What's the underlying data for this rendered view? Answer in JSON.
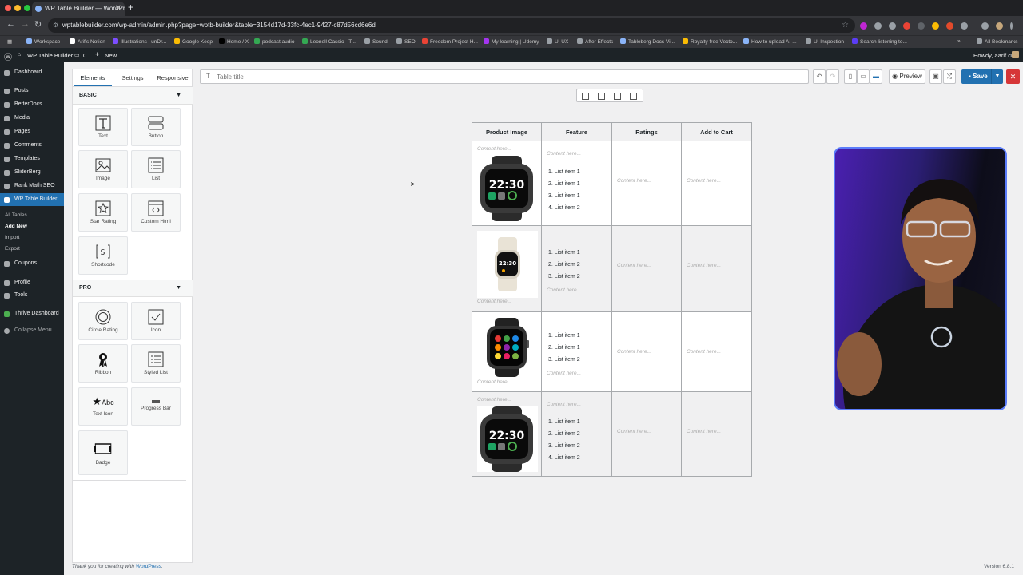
{
  "browser": {
    "tab_title": "WP Table Builder — WordPre",
    "url": "wptablebuilder.com/wp-admin/admin.php?page=wptb-builder&table=3154d17d-33fc-4ec1-9427-c87d56cd6e6d",
    "bookmarks": [
      "Workspace",
      "Arif's Notion",
      "Illustrations | unDr...",
      "Google Keep",
      "Home / X",
      "podcast audio",
      "Leonell Cassio - T...",
      "Sound",
      "SEO",
      "Freedom Project H...",
      "My learning | Udemy",
      "UI UX",
      "After Effects",
      "Tableberg Docs Vi...",
      "Royalty free Vecto...",
      "How to upload AI-...",
      "UI Inspection",
      "Search listening to..."
    ],
    "all_bookmarks": "All Bookmarks"
  },
  "admin_bar": {
    "site": "WP Table Builder",
    "comments": "0",
    "new": "New",
    "howdy": "Howdy, aarif.cu"
  },
  "sidebar": {
    "items": [
      "Dashboard",
      "Posts",
      "BetterDocs",
      "Media",
      "Pages",
      "Comments",
      "Templates",
      "SliderBerg",
      "Rank Math SEO",
      "WP Table Builder"
    ],
    "sub": [
      "All Tables",
      "Add New",
      "Import",
      "Export"
    ],
    "lower": [
      "Coupons",
      "Profile",
      "Tools",
      "Thrive Dashboard",
      "Collapse Menu"
    ]
  },
  "panel": {
    "tabs": [
      "Elements",
      "Settings",
      "Responsive"
    ],
    "basic_label": "BASIC",
    "pro_label": "PRO",
    "basic": [
      "Text",
      "Button",
      "Image",
      "List",
      "Star Rating",
      "Custom Html",
      "Shortcode"
    ],
    "pro": [
      "Circle Rating",
      "Icon",
      "Ribbon",
      "Styled List",
      "Text Icon",
      "Progress Bar",
      "Badge"
    ],
    "abc": "Abc"
  },
  "toolbar": {
    "title_placeholder": "Table title",
    "preview": "Preview",
    "save": "Save"
  },
  "table": {
    "headers": [
      "Product Image",
      "Feature",
      "Ratings",
      "Add to Cart"
    ],
    "placeholder": "Content here...",
    "rows": [
      {
        "items": [
          "1. List item 1",
          "2. List item 1",
          "3. List item 1",
          "4. List item 2"
        ]
      },
      {
        "items": [
          "1. List item 1",
          "2. List item 2",
          "3. List item 2"
        ]
      },
      {
        "items": [
          "1. List item 1",
          "2. List item 1",
          "3. List item 2"
        ]
      },
      {
        "items": [
          "1. List item 1",
          "2. List item 2",
          "3. List item 2",
          "4. List item 2"
        ]
      }
    ],
    "watch_time": "22:30"
  },
  "footer": {
    "thanks": "Thank you for creating with",
    "link": "WordPress",
    "version": "Version 6.8.1"
  },
  "colors": {
    "accent": "#2271b1",
    "admin_dark": "#1d2327",
    "danger": "#d63638"
  }
}
